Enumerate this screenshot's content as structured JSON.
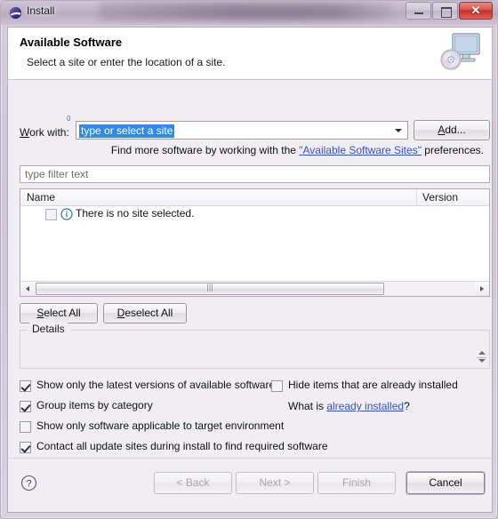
{
  "window": {
    "title": "Install",
    "app_icon": "eclipse-globe-icon",
    "controls": {
      "minimize": "minimize-icon",
      "maximize": "maximize-icon",
      "close": "✕"
    }
  },
  "header": {
    "title": "Available Software",
    "description": "Select a site or enter the location of a site.",
    "icon": "computer-disc-icon"
  },
  "work_with": {
    "label": "Work with:",
    "label_mnemonic": "W",
    "combo_value": "type or select a site",
    "combo_selected": true,
    "decoration": "0",
    "add_button": "Add...",
    "add_button_mnemonic": "A",
    "dropdown_icon": "chevron-down-icon"
  },
  "hint": {
    "prefix": "Find more software by working with the ",
    "link": "\"Available Software Sites\"",
    "suffix": " preferences."
  },
  "filter": {
    "placeholder": "type filter text",
    "value": ""
  },
  "tree": {
    "columns": [
      "Name",
      "Version"
    ],
    "rows": [
      {
        "checked": false,
        "icon": "info-icon",
        "name": "There is no site selected.",
        "version": ""
      }
    ],
    "scrollbar": {
      "left_arrow": "arrow-left-icon",
      "right_arrow": "arrow-right-icon",
      "grip": "|||"
    }
  },
  "selection_buttons": {
    "select_all": "Select All",
    "select_all_mnemonic": "S",
    "deselect_all": "Deselect All",
    "deselect_all_mnemonic": "D"
  },
  "details": {
    "label": "Details",
    "content": "",
    "spinner": "spinner-updown-icon"
  },
  "options": {
    "left": [
      {
        "label": "Show only the latest versions of available software",
        "checked": true,
        "mnemonic": "l"
      },
      {
        "label": "Group items by category",
        "checked": true,
        "mnemonic": "G"
      },
      {
        "label": "Show only software applicable to target environment",
        "checked": false,
        "mnemonic": ""
      },
      {
        "label": "Contact all update sites during install to find required software",
        "checked": true,
        "mnemonic": "C"
      }
    ],
    "right": [
      {
        "label": "Hide items that are already installed",
        "checked": false,
        "mnemonic": "H"
      }
    ],
    "right_hint": {
      "prefix": "What is ",
      "link": "already installed",
      "suffix": "?"
    }
  },
  "footer": {
    "help_icon": "help-question-icon",
    "buttons": [
      {
        "label": "< Back",
        "enabled": false,
        "mnemonic": "B"
      },
      {
        "label": "Next >",
        "enabled": false,
        "mnemonic": "N"
      },
      {
        "label": "Finish",
        "enabled": false,
        "mnemonic": "F"
      },
      {
        "label": "Cancel",
        "enabled": true,
        "mnemonic": ""
      }
    ]
  },
  "colors": {
    "selection_blue": "#2e8be6",
    "link_blue": "#2a58c6",
    "close_red": "#c22e29",
    "frame_lavender": "#cfc6d6",
    "dialog_bg": "#f0eef2"
  }
}
